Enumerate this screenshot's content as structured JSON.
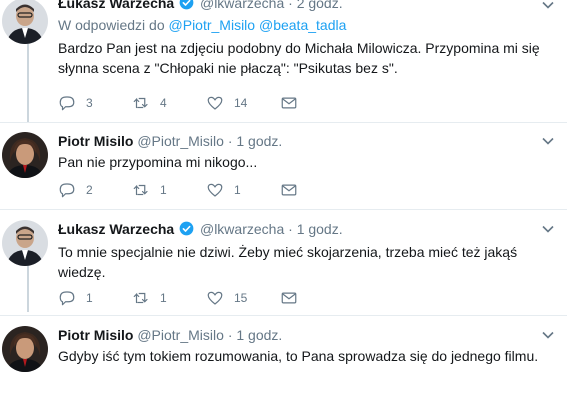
{
  "tweets": [
    {
      "name": "Łukasz Warzecha",
      "handle": "@lkwarzecha",
      "dot": "·",
      "time": "2 godz.",
      "reply_prefix": "W odpowiedzi do",
      "reply_mentions": [
        "@Piotr_Misilo",
        "@beata_tadla"
      ],
      "text_line1": "Bardzo Pan jest na zdjęciu podobny do Michała Milowicza. Przypomina mi się",
      "text_line2": "słynna scena z \"Chłopaki nie płaczą\": \"Psikutas bez s\".",
      "replies": "3",
      "retweets": "4",
      "likes": "14"
    },
    {
      "name": "Piotr Misilo",
      "handle": "@Piotr_Misilo",
      "dot": "·",
      "time": "1 godz.",
      "text_line1": "Pan nie przypomina mi nikogo...",
      "replies": "2",
      "retweets": "1",
      "likes": "1"
    },
    {
      "name": "Łukasz Warzecha",
      "handle": "@lkwarzecha",
      "dot": "·",
      "time": "1 godz.",
      "text_line1": "To mnie specjalnie nie dziwi. Żeby mieć skojarzenia, trzeba mieć też jakąś",
      "text_line2": "wiedzę.",
      "replies": "1",
      "retweets": "1",
      "likes": "15"
    },
    {
      "name": "Piotr Misilo",
      "handle": "@Piotr_Misilo",
      "dot": "·",
      "time": "1 godz.",
      "text_line1": "Gdyby iść tym tokiem rozumowania, to Pana sprowadza się do jednego filmu."
    }
  ],
  "colors": {
    "accent": "#1da1f2",
    "muted": "#657786",
    "thread_line": "#ccd6dd",
    "separator": "#e6ecf0"
  }
}
